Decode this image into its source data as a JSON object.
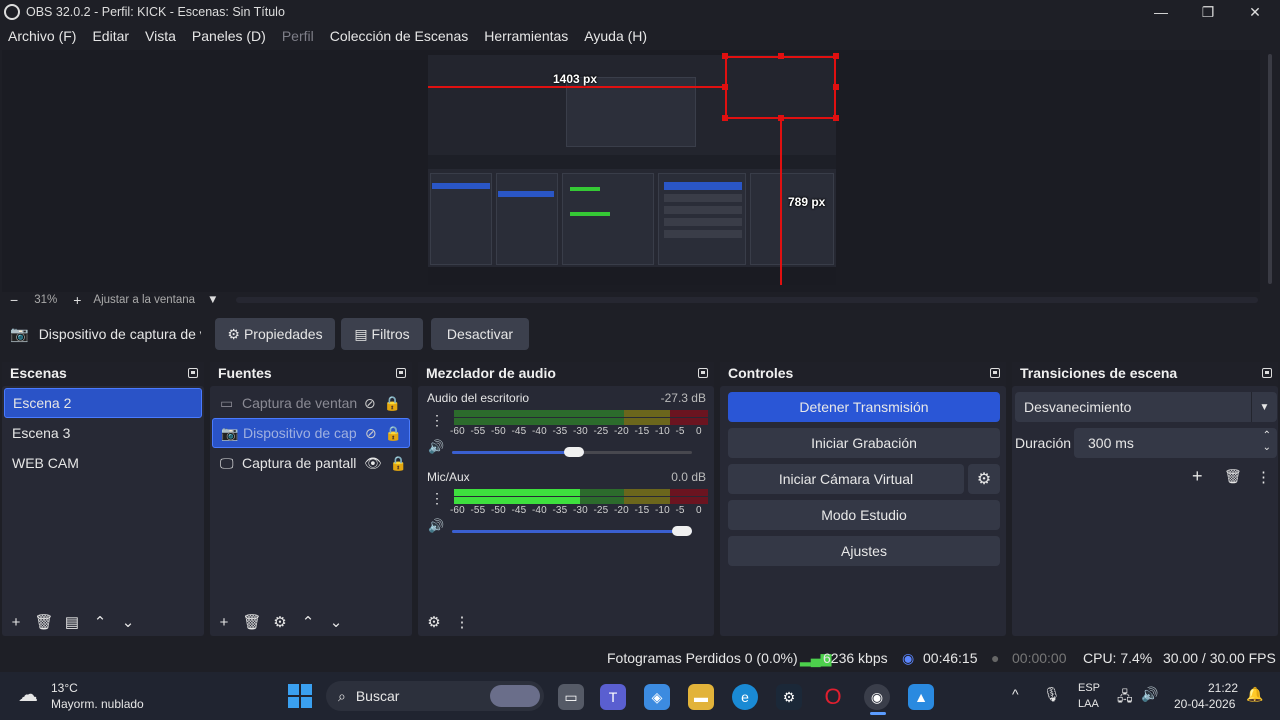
{
  "window": {
    "title": "OBS 32.0.2 - Perfil: KICK - Escenas: Sin Título",
    "minimize": "—",
    "maximize": "❐",
    "close": "✕"
  },
  "menu": {
    "items": [
      "Archivo (F)",
      "Editar",
      "Vista",
      "Paneles (D)",
      "Perfil",
      "Colección de Escenas",
      "Herramientas",
      "Ayuda (H)"
    ]
  },
  "preview": {
    "width_label": "1403 px",
    "height_label": "789 px",
    "zoom_minus": "−",
    "zoom_level": "31%",
    "zoom_plus": "+",
    "fit_label": "Ajustar a la ventana"
  },
  "source_toolbar": {
    "source_name": "Dispositivo de captura de v",
    "properties": "Propiedades",
    "filters": "Filtros",
    "deactivate": "Desactivar"
  },
  "scenes": {
    "title": "Escenas",
    "items": [
      "Escena 2",
      "Escena 3",
      "WEB CAM"
    ]
  },
  "sources": {
    "title": "Fuentes",
    "items": [
      "Captura de ventan",
      "Dispositivo de cap",
      "Captura de pantall"
    ]
  },
  "mixer": {
    "title": "Mezclador de audio",
    "channels": [
      {
        "name": "Audio del escritorio",
        "db": "-27.3 dB",
        "volume": 0.55
      },
      {
        "name": "Mic/Aux",
        "db": "0.0 dB",
        "volume": 1.0
      }
    ],
    "ticks": [
      "-60",
      "-55",
      "-50",
      "-45",
      "-40",
      "-35",
      "-30",
      "-25",
      "-20",
      "-15",
      "-10",
      "-5",
      "0"
    ]
  },
  "controls": {
    "title": "Controles",
    "stop_stream": "Detener Transmisión",
    "start_recording": "Iniciar Grabación",
    "start_virtual_cam": "Iniciar Cámara Virtual",
    "studio_mode": "Modo Estudio",
    "settings": "Ajustes"
  },
  "transitions": {
    "title": "Transiciones de escena",
    "selected": "Desvanecimiento",
    "duration_label": "Duración",
    "duration_value": "300 ms"
  },
  "status": {
    "dropped_frames": "Fotogramas Perdidos 0 (0.0%)",
    "bitrate": "6236 kbps",
    "stream_time": "00:46:15",
    "record_time": "00:00:00",
    "cpu": "CPU: 7.4%",
    "fps": "30.00 / 30.00 FPS"
  },
  "taskbar": {
    "weather_temp": "13°C",
    "weather_desc": "Mayorm. nublado",
    "search": "Buscar",
    "lang_top": "ESP",
    "lang_bottom": "LAA",
    "time": "21:22",
    "date": "20-04-2026"
  },
  "colors": {
    "accent": "#2a56d6",
    "panel_bg": "#272935",
    "window_bg": "#1e1f26",
    "meter_green": "#35c935",
    "meter_yellow": "#a69b1e",
    "meter_red": "#9a1828",
    "guide_red": "#e01010"
  }
}
